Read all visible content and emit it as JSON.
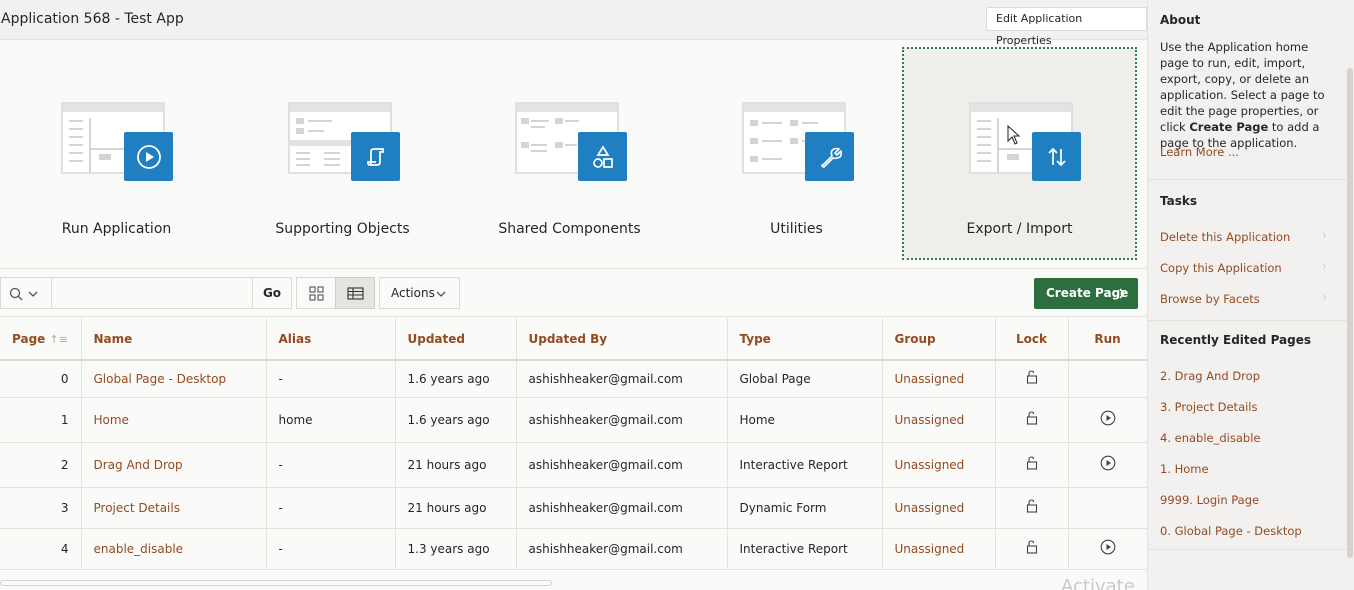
{
  "header": {
    "title": "Application 568 - Test App",
    "edit_properties_label": "Edit Application Properties"
  },
  "tiles": [
    {
      "label": "Run Application",
      "icon": "play-icon"
    },
    {
      "label": "Supporting Objects",
      "icon": "scroll-icon"
    },
    {
      "label": "Shared Components",
      "icon": "shapes-icon"
    },
    {
      "label": "Utilities",
      "icon": "wrench-icon"
    },
    {
      "label": "Export / Import",
      "icon": "arrows-updown-icon"
    }
  ],
  "toolbar": {
    "search_placeholder": "",
    "go_label": "Go",
    "actions_label": "Actions",
    "create_page_label": "Create Page"
  },
  "grid": {
    "columns": [
      "Page",
      "Name",
      "Alias",
      "Updated",
      "Updated By",
      "Type",
      "Group",
      "Lock",
      "Run"
    ],
    "rows": [
      {
        "page": "0",
        "name": "Global Page - Desktop",
        "alias": "-",
        "updated": "1.6 years ago",
        "updated_by": "ashishheaker@gmail.com",
        "type": "Global Page",
        "group": "Unassigned",
        "run": false
      },
      {
        "page": "1",
        "name": "Home",
        "alias": "home",
        "updated": "1.6 years ago",
        "updated_by": "ashishheaker@gmail.com",
        "type": "Home",
        "group": "Unassigned",
        "run": true
      },
      {
        "page": "2",
        "name": "Drag And Drop",
        "alias": "-",
        "updated": "21 hours ago",
        "updated_by": "ashishheaker@gmail.com",
        "type": "Interactive Report",
        "group": "Unassigned",
        "run": true
      },
      {
        "page": "3",
        "name": "Project Details",
        "alias": "-",
        "updated": "21 hours ago",
        "updated_by": "ashishheaker@gmail.com",
        "type": "Dynamic Form",
        "group": "Unassigned",
        "run": false
      },
      {
        "page": "4",
        "name": "enable_disable",
        "alias": "-",
        "updated": "1.3 years ago",
        "updated_by": "ashishheaker@gmail.com",
        "type": "Interactive Report",
        "group": "Unassigned",
        "run": true
      }
    ]
  },
  "sidebar": {
    "about_heading": "About",
    "about_text_1": "Use the Application home page to run, edit, import, export, copy, or delete an application. Select a page to edit the page properties, or click ",
    "about_text_bold": "Create Page",
    "about_text_2": " to add a page to the application.",
    "learn_more": "Learn More ...",
    "tasks_heading": "Tasks",
    "tasks": [
      "Delete this Application",
      "Copy this Application",
      "Browse by Facets"
    ],
    "recent_heading": "Recently Edited Pages",
    "recent": [
      "2. Drag And Drop",
      "3. Project Details",
      "4. enable_disable",
      "1. Home",
      "9999. Login Page",
      "0. Global Page - Desktop"
    ]
  },
  "watermark": "Activate Windows",
  "colors": {
    "accent_blue": "#1f7fc1",
    "link_brown": "#934b22",
    "create_green": "#2c6e3f",
    "focus_dotted": "#2e7d4f"
  }
}
